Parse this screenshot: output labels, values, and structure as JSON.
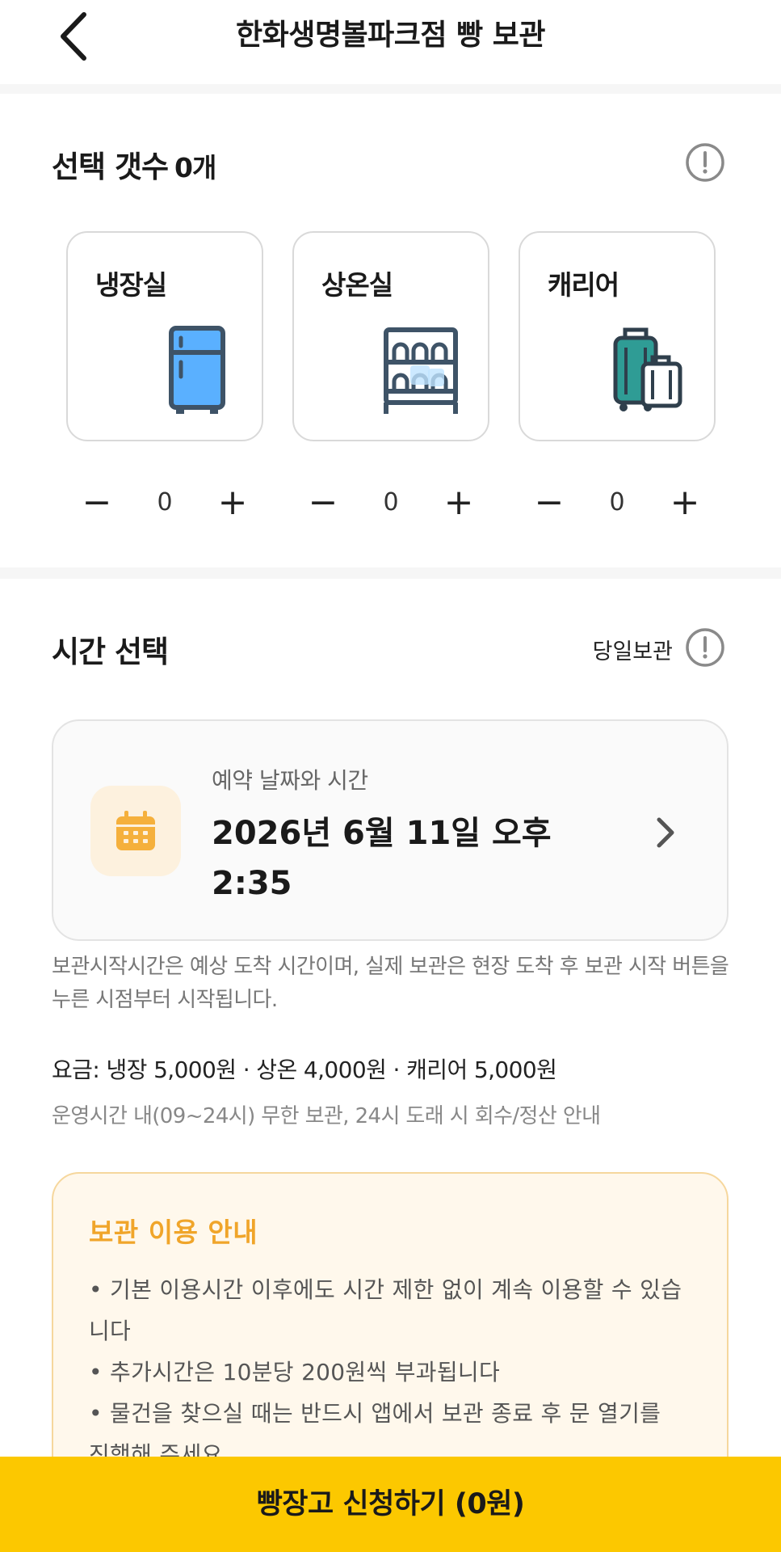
{
  "header": {
    "title": "한화생명볼파크점 빵 보관"
  },
  "selection": {
    "title": "선택 갯수",
    "count": "0개",
    "items": [
      {
        "label": "냉장실",
        "icon": "refrigerator-icon",
        "value": "0"
      },
      {
        "label": "상온실",
        "icon": "shelf-icon",
        "value": "0"
      },
      {
        "label": "캐리어",
        "icon": "luggage-icon",
        "value": "0"
      }
    ],
    "minus": "−",
    "plus": "+"
  },
  "time": {
    "title": "시간 선택",
    "same_day_label": "당일보관",
    "card_label": "예약 날짜와 시간",
    "card_value": "2026년 6월 11일 오후 2:35",
    "note": "보관시작시간은 예상 도착 시간이며, 실제 보관은 현장 도착 후 보관 시작 버튼을 누른 시점부터 시작됩니다.",
    "fee": "요금: 냉장 5,000원 · 상온 4,000원 · 캐리어 5,000원",
    "hours": "운영시간 내(09~24시) 무한 보관, 24시 도래 시 회수/정산 안내"
  },
  "guide": {
    "title": "보관 이용 안내",
    "items": [
      "• 기본 이용시간 이후에도 시간 제한 없이 계속 이용할 수 있습니다",
      "• 추가시간은 10분당 200원씩 부과됩니다",
      "• 물건을 찾으실 때는 반드시 앱에서 보관 종료 후 문 열기를 진행해 주세요"
    ]
  },
  "cta": {
    "label": "빵장고 신청하기 (0원)"
  },
  "colors": {
    "accent": "#fcc800",
    "guide_title": "#f0a52a",
    "fridge_blue": "#5ab0ff",
    "luggage_teal": "#2f9c95"
  }
}
